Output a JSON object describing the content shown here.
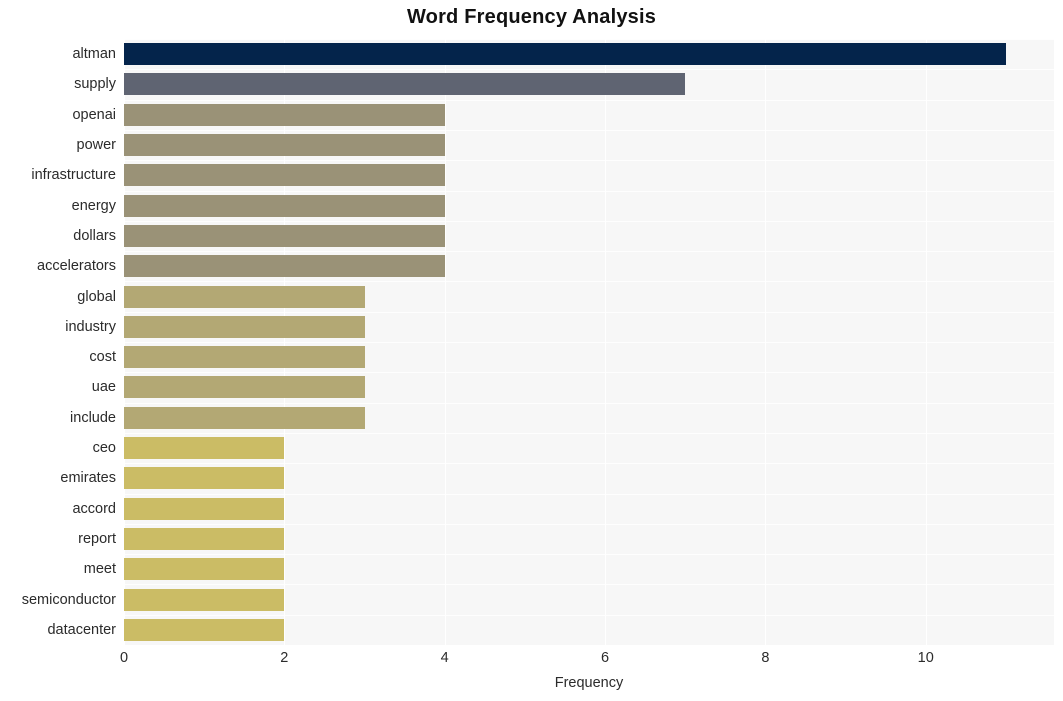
{
  "chart_data": {
    "type": "bar",
    "orientation": "horizontal",
    "title": "Word Frequency Analysis",
    "xlabel": "Frequency",
    "ylabel": "",
    "xlim": [
      0,
      11.6
    ],
    "xticks": [
      0,
      2,
      4,
      6,
      8,
      10
    ],
    "xtick_labels": [
      "0",
      "2",
      "4",
      "6",
      "8",
      "10"
    ],
    "grid": true,
    "legend": null,
    "categories": [
      "altman",
      "supply",
      "openai",
      "power",
      "infrastructure",
      "energy",
      "dollars",
      "accelerators",
      "global",
      "industry",
      "cost",
      "uae",
      "include",
      "ceo",
      "emirates",
      "accord",
      "report",
      "meet",
      "semiconductor",
      "datacenter"
    ],
    "values": [
      11,
      7,
      4,
      4,
      4,
      4,
      4,
      4,
      3,
      3,
      3,
      3,
      3,
      2,
      2,
      2,
      2,
      2,
      2,
      2
    ],
    "bar_colors": [
      "#04244b",
      "#5f6472",
      "#9a9277",
      "#9a9277",
      "#9a9277",
      "#9a9277",
      "#9a9277",
      "#9a9277",
      "#b3a874",
      "#b3a874",
      "#b3a874",
      "#b3a874",
      "#b3a874",
      "#cbbc65",
      "#cbbc65",
      "#cbbc65",
      "#cbbc65",
      "#cbbc65",
      "#cbbc65",
      "#cbbc65"
    ],
    "plot_background": "#f7f7f7",
    "figure_background": "#ffffff",
    "gridline_color": "#ffffff"
  }
}
